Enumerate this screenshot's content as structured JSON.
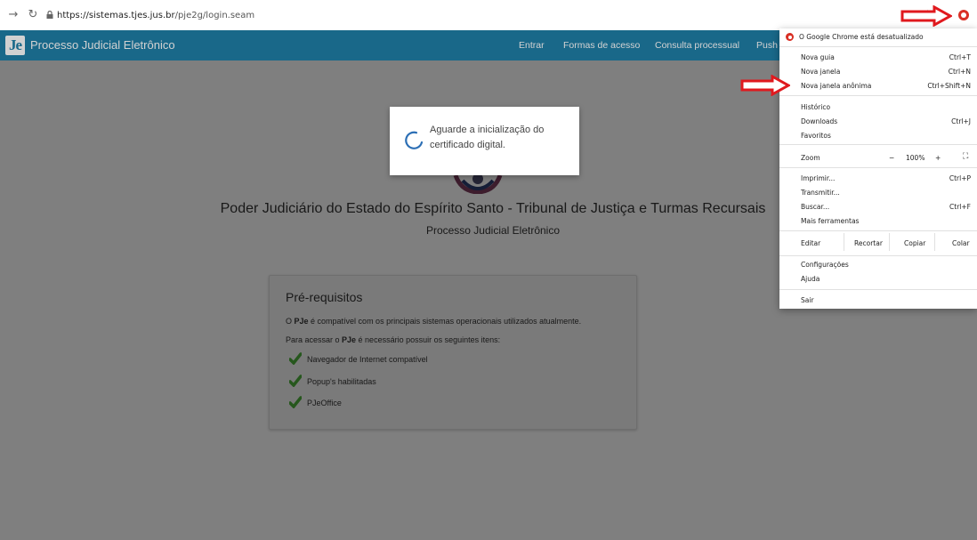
{
  "browser": {
    "back_icon": "arrow-right",
    "reload_icon": "reload",
    "url_domain": "https://sistemas.tjes.jus.br",
    "url_path": "/pje2g/login.seam"
  },
  "header": {
    "app_title": "Processo Judicial Eletrônico",
    "logo_text": "Je",
    "nav": [
      "Entrar",
      "Formas de acesso",
      "Consulta processual",
      "Push"
    ]
  },
  "main": {
    "title": "Poder Judiciário do Estado do Espírito Santo - Tribunal de Justiça e Turmas Recursais",
    "subtitle": "Processo Judicial Eletrônico"
  },
  "prereq": {
    "heading": "Pré-requisitos",
    "line1_prefix": "O ",
    "line1_bold": "PJe",
    "line1_suffix": " é compatível com os principais sistemas operacionais utilizados atualmente.",
    "line2_prefix": "Para acessar o ",
    "line2_bold": "PJe",
    "line2_suffix": " é necessário possuir os seguintes itens:",
    "items": [
      "Navegador de Internet compatível",
      "Popup's habilitadas",
      "PJeOffice"
    ]
  },
  "dialog": {
    "line1": "Aguarde a inicialização do",
    "line2": "certificado digital."
  },
  "menu": {
    "warning": "O Google Chrome está desatualizado",
    "new_tab": "Nova guia",
    "new_tab_sc": "Ctrl+T",
    "new_window": "Nova janela",
    "new_window_sc": "Ctrl+N",
    "incognito": "Nova janela anônima",
    "incognito_sc": "Ctrl+Shift+N",
    "history": "Histórico",
    "downloads": "Downloads",
    "downloads_sc": "Ctrl+J",
    "favorites": "Favoritos",
    "zoom": "Zoom",
    "zoom_minus": "−",
    "zoom_value": "100%",
    "zoom_plus": "+",
    "fullscreen_icon": "fullscreen",
    "print": "Imprimir...",
    "print_sc": "Ctrl+P",
    "cast": "Transmitir...",
    "find": "Buscar...",
    "find_sc": "Ctrl+F",
    "more_tools": "Mais ferramentas",
    "edit": "Editar",
    "cut": "Recortar",
    "copy": "Copiar",
    "paste": "Colar",
    "settings": "Configurações",
    "help": "Ajuda",
    "exit": "Sair"
  },
  "colors": {
    "header_bg": "#1f7fa8",
    "annotation_arrow": "#e0191e",
    "check_green": "#4caf3a"
  }
}
